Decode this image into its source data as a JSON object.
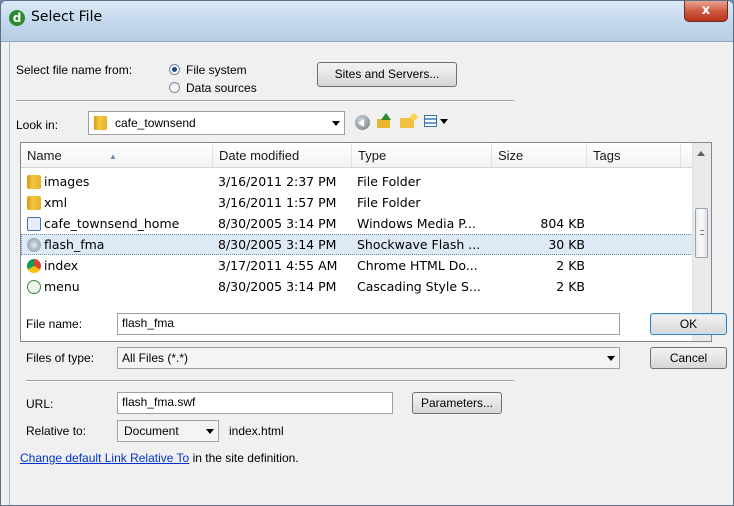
{
  "window": {
    "title": "Select File",
    "close_label": "x"
  },
  "source": {
    "label": "Select file name from:",
    "options": [
      "File system",
      "Data sources"
    ],
    "selected": "File system",
    "sites_button": "Sites and Servers..."
  },
  "lookin": {
    "label": "Look in:",
    "folder": "cafe_townsend",
    "toolbar_icons": [
      "back-icon",
      "up-folder-icon",
      "new-folder-icon",
      "view-menu-icon"
    ]
  },
  "filelist": {
    "columns": [
      "Name",
      "Date modified",
      "Type",
      "Size",
      "Tags"
    ],
    "rows": [
      {
        "name": "images",
        "date": "3/16/2011 2:37 PM",
        "type": "File Folder",
        "size": "",
        "icon": "folder-icon"
      },
      {
        "name": "xml",
        "date": "3/16/2011 1:57 PM",
        "type": "File Folder",
        "size": "",
        "icon": "folder-icon"
      },
      {
        "name": "cafe_townsend_home",
        "date": "8/30/2005 3:14 PM",
        "type": "Windows Media P...",
        "size": "804 KB",
        "icon": "media-file-icon"
      },
      {
        "name": "flash_fma",
        "date": "8/30/2005 3:14 PM",
        "type": "Shockwave Flash ...",
        "size": "30 KB",
        "icon": "flash-file-icon",
        "selected": true
      },
      {
        "name": "index",
        "date": "3/17/2011 4:55 AM",
        "type": "Chrome HTML Do...",
        "size": "2 KB",
        "icon": "chrome-icon"
      },
      {
        "name": "menu",
        "date": "8/30/2005 3:14 PM",
        "type": "Cascading Style S...",
        "size": "2 KB",
        "icon": "css-file-icon"
      }
    ]
  },
  "filename": {
    "label": "File name:",
    "value": "flash_fma",
    "ok": "OK"
  },
  "filetype": {
    "label": "Files of type:",
    "value": "All Files (*.*)",
    "cancel": "Cancel"
  },
  "url": {
    "label": "URL:",
    "value": "flash_fma.swf",
    "parameters": "Parameters..."
  },
  "relative": {
    "label": "Relative to:",
    "value": "Document",
    "file": "index.html"
  },
  "footer": {
    "link": "Change default Link Relative To",
    "rest": " in the site definition."
  }
}
